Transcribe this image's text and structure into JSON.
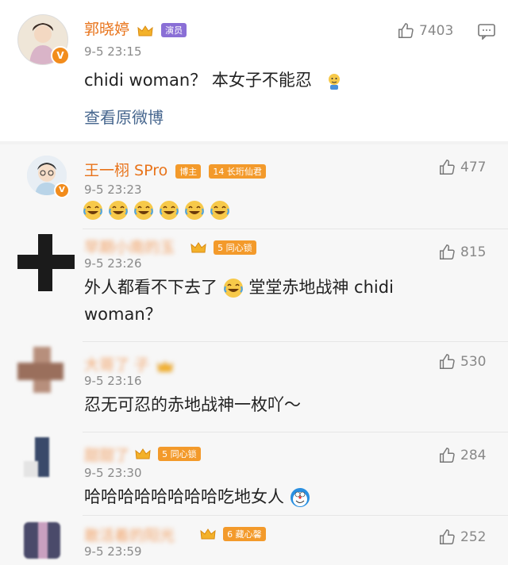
{
  "post": {
    "author": "郭晓婷",
    "badge": "演员",
    "time": "9-5 23:15",
    "likes": "7403",
    "text": "chidi woman？ 本女子不能忍",
    "link": "查看原微博"
  },
  "comments": [
    {
      "name": "王一栩 SPro",
      "badge1": "博主",
      "badge2_num": "14",
      "badge2": "长珩仙君",
      "time": "9-5 23:23",
      "likes": "477",
      "text": "",
      "emoji_count": 6
    },
    {
      "name": "早期小南的玉",
      "badge2_num": "5",
      "badge2": "同心锁",
      "time": "9-5 23:26",
      "likes": "815",
      "text1": "外人都看不下去了",
      "text2": "堂堂赤地战神 chidi",
      "text3": "woman？"
    },
    {
      "name": "大哥了     子",
      "time": "9-5 23:16",
      "likes": "530",
      "text": "忍无可忍的赤地战神一枚吖～"
    },
    {
      "name": "甜甜了",
      "badge2_num": "5",
      "badge2": "同心锁",
      "time": "9-5 23:30",
      "likes": "284",
      "text": "哈哈哈哈哈哈哈哈吃地女人"
    },
    {
      "name": "敢活着的阳光",
      "badge2_num": "6",
      "badge2": "藏心馨",
      "time": "9-5 23:59",
      "likes": "252"
    }
  ],
  "colors": {
    "name": "#e8731a",
    "link": "#46668e",
    "time": "#8a8a8a",
    "badge_actor": "#8a6fd6",
    "badge_fan": "#f39a2b"
  },
  "icons": [
    "thumb-up-icon",
    "comment-icon",
    "crown-icon",
    "verified-icon",
    "laugh-cry-emoji",
    "doraemon-emoji",
    "shrug-emoji"
  ]
}
